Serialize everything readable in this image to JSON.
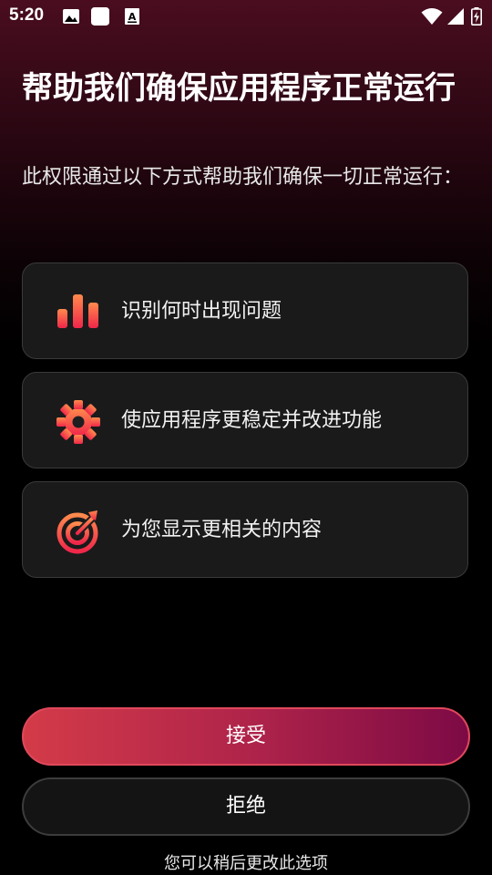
{
  "status_bar": {
    "time": "5:20",
    "left_icons": [
      "image-icon",
      "square-app-icon",
      "font-a-icon"
    ],
    "right_icons": [
      "wifi-icon",
      "signal-icon",
      "battery-charging-icon"
    ]
  },
  "header": {
    "title": "帮助我们确保应用程序正常运行",
    "subtitle": "此权限通过以下方式帮助我们确保一切正常运行："
  },
  "features": [
    {
      "icon": "bar-chart-icon",
      "label": "识别何时出现问题"
    },
    {
      "icon": "gear-icon",
      "label": "使应用程序更稳定并改进功能"
    },
    {
      "icon": "target-icon",
      "label": "为您显示更相关的内容"
    }
  ],
  "actions": {
    "accept_label": "接受",
    "reject_label": "拒绝"
  },
  "footer": {
    "note": "您可以稍后更改此选项"
  },
  "colors": {
    "accent_start": "#d33b48",
    "accent_end": "#7d0a45",
    "icon_gradient_top": "#ff8a4c",
    "icon_gradient_bottom": "#f0264a"
  }
}
